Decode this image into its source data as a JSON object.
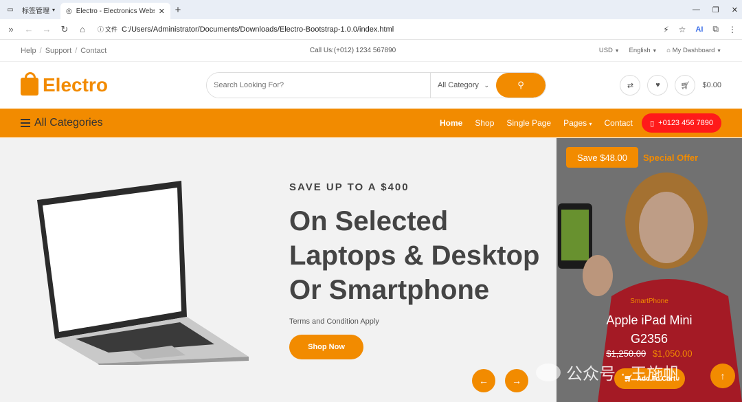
{
  "browser": {
    "tab_group_label": "标签管理",
    "tab_title": "Electro - Electronics Website",
    "new_tab": "+",
    "file_label": "文件",
    "url": "C:/Users/Administrator/Documents/Downloads/Electro-Bootstrap-1.0.0/index.html",
    "ai_label": "AI"
  },
  "topbar": {
    "links": [
      "Help",
      "Support",
      "Contact"
    ],
    "call": "Call Us:(+012) 1234 567890",
    "currency": "USD",
    "language": "English",
    "dashboard": "My Dashboard"
  },
  "header": {
    "logo": "Electro",
    "search_placeholder": "Search Looking For?",
    "category": "All Category",
    "cart_total": "$0.00"
  },
  "nav": {
    "all_categories": "All Categories",
    "links": [
      "Home",
      "Shop",
      "Single Page",
      "Pages",
      "Contact"
    ],
    "phone": "+0123 456 7890"
  },
  "hero": {
    "eyebrow": "SAVE UP TO A $400",
    "title_lines": [
      "On Selected",
      "Laptops & Desktop",
      "Or Smartphone"
    ],
    "terms": "Terms and Condition Apply",
    "cta": "Shop Now"
  },
  "promo": {
    "save": "Save $48.00",
    "special": "Special Offer",
    "category": "SmartPhone",
    "name_line1": "Apple iPad Mini",
    "name_line2": "G2356",
    "old_price": "$1,250.00",
    "new_price": "$1,050.00",
    "add_to_cart": "Add To Cart"
  },
  "watermark": "公众号 · 王施帆",
  "colors": {
    "accent": "#f28b00",
    "phone_btn": "#ff1a1a"
  }
}
